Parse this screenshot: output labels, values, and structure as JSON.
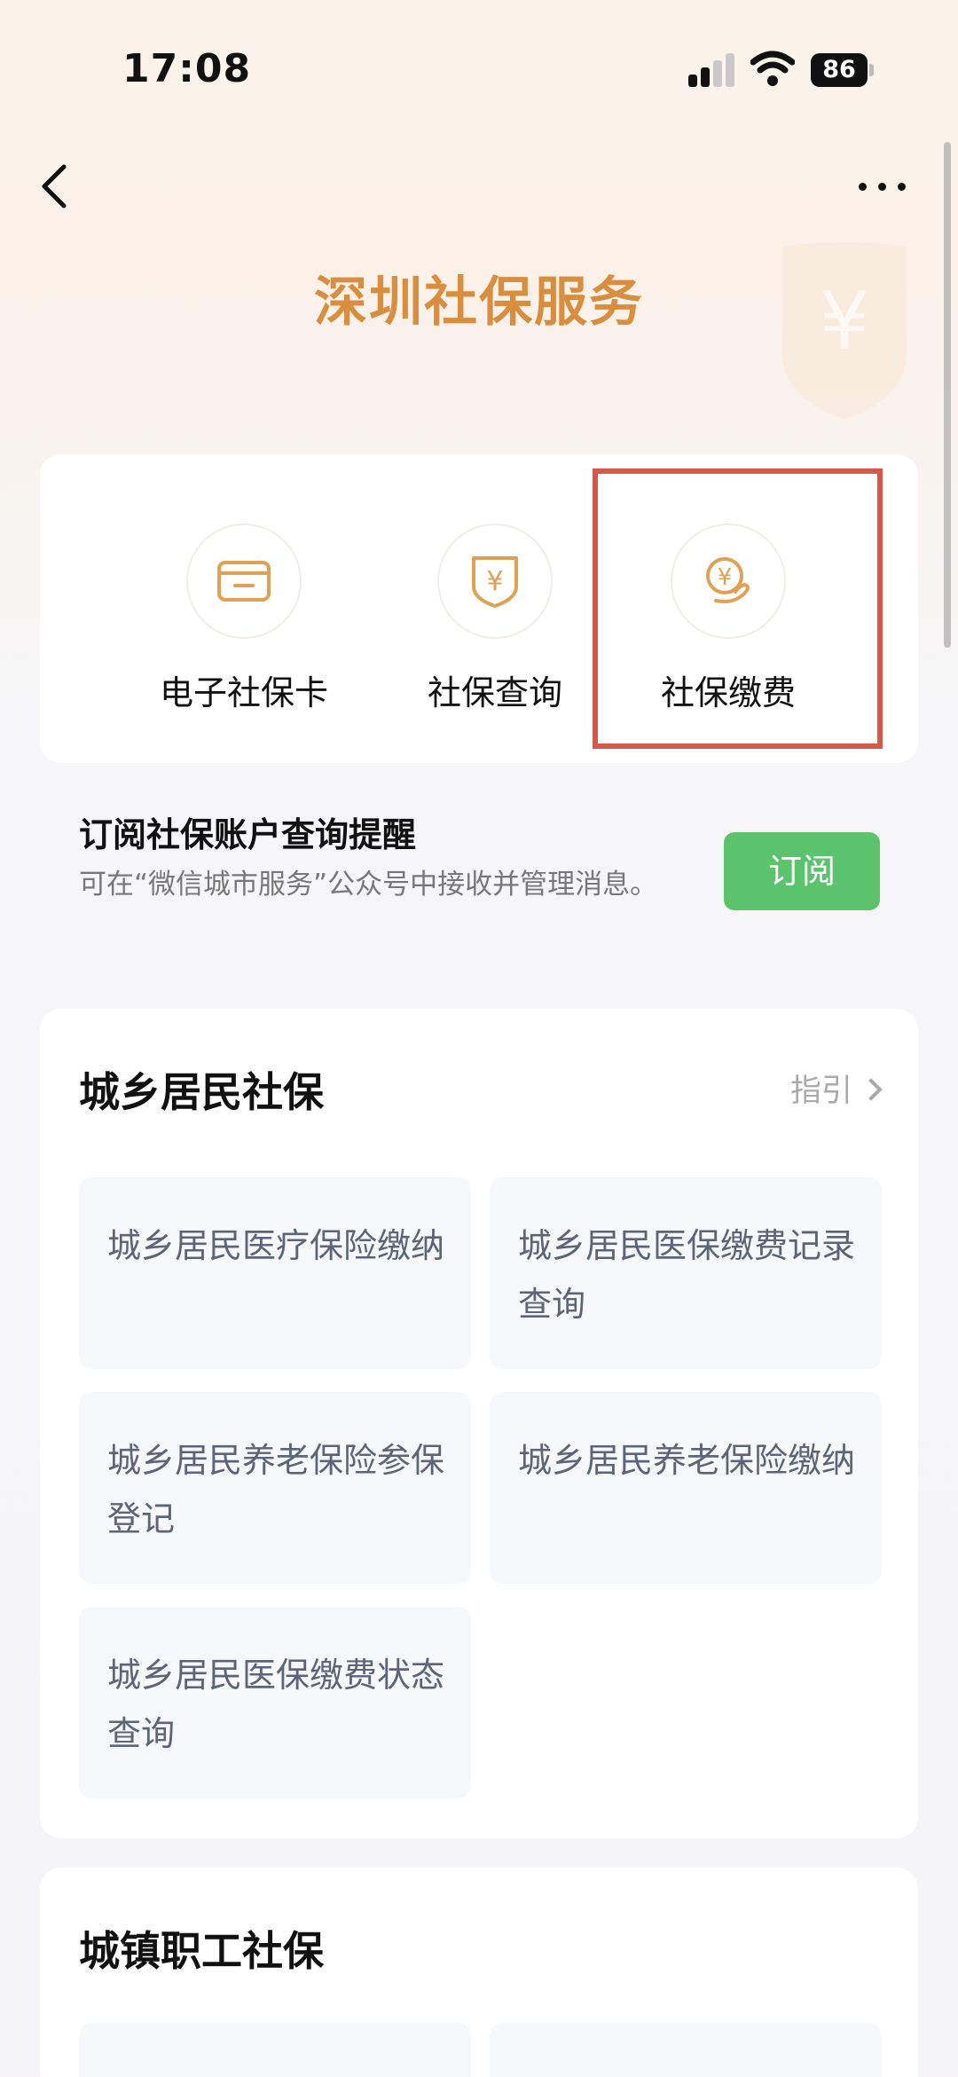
{
  "status_bar": {
    "time": "17:08",
    "battery": "86"
  },
  "page": {
    "title": "深圳社保服务"
  },
  "quick_actions": [
    {
      "label": "电子社保卡",
      "icon": "card-icon"
    },
    {
      "label": "社保查询",
      "icon": "yuan-shield-icon"
    },
    {
      "label": "社保缴费",
      "icon": "yuan-hand-icon"
    }
  ],
  "subscribe": {
    "title": "订阅社保账户查询提醒",
    "description": "可在“微信城市服务”公众号中接收并管理消息。",
    "button": "订阅"
  },
  "section_resident": {
    "title": "城乡居民社保",
    "guide": "指引",
    "items": [
      "城乡居民医疗保险缴纳",
      "城乡居民医保缴费记录查询",
      "城乡居民养老保险参保登记",
      "城乡居民养老保险缴纳",
      "城乡居民医保缴费状态查询"
    ]
  },
  "section_employee": {
    "title": "城镇职工社保"
  },
  "colors": {
    "accent": "#d98e3f",
    "highlight": "#d6584a",
    "subscribe": "#5cc36d"
  }
}
